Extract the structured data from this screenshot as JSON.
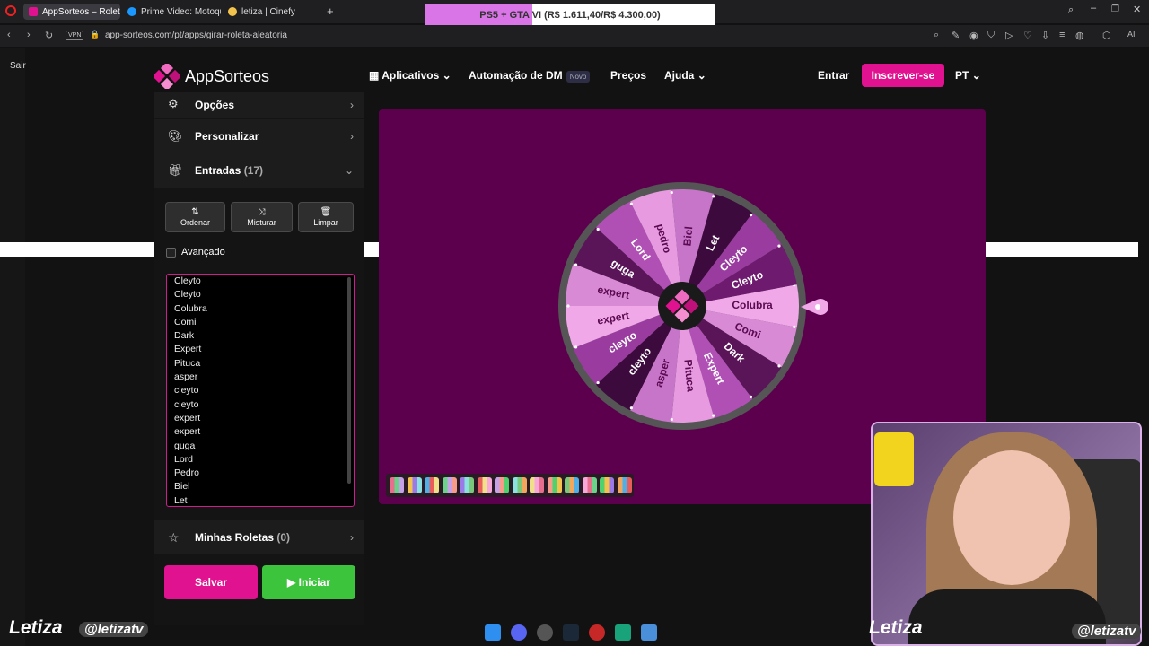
{
  "browser": {
    "tabs": [
      {
        "label": "AppSorteos – Roleta Alea",
        "active": true
      },
      {
        "label": "Prime Video: Motoqueiro"
      },
      {
        "label": "letiza | Cinefy"
      }
    ],
    "new_tab": "+",
    "promo": "PS5 + GTA VI (R$ 1.611,40/R$ 4.300,00)",
    "promo_progress": 0.37,
    "url": "app-sorteos.com/pt/apps/girar-roleta-aleatoria",
    "vpn": "VPN"
  },
  "sidebar": {
    "sair": "Sair"
  },
  "header": {
    "logo": "AppSorteos",
    "nav": {
      "apps": "Aplicativos",
      "dm": "Automação de DM",
      "dm_badge": "Novo",
      "prices": "Preços",
      "help": "Ajuda"
    },
    "login": "Entrar",
    "signup": "Inscrever-se",
    "lang": "PT"
  },
  "panel": {
    "options": "Opções",
    "customize": "Personalizar",
    "entries": "Entradas",
    "entries_count": "(17)",
    "tools": {
      "sort": "Ordenar",
      "shuffle": "Misturar",
      "clear": "Limpar"
    },
    "advanced": "Avançado",
    "entries_list": [
      "Cleyto",
      "Cleyto",
      "Colubra",
      "Comi",
      "Dark",
      "Expert",
      "Pituca",
      "asper",
      "cleyto",
      "cleyto",
      "expert",
      "expert",
      "guga",
      "Lord",
      "Pedro",
      "Biel",
      "Let"
    ],
    "my_wheels": "Minhas Roletas",
    "my_wheels_count": "(0)",
    "save": "Salvar",
    "start": "Iniciar"
  },
  "wheel": {
    "segments": [
      "Colubra",
      "Comi",
      "Dark",
      "Expert",
      "Pituca",
      "asper",
      "cleyto",
      "cleyto",
      "expert",
      "expert",
      "guga",
      "Lord",
      "pedro",
      "Biel",
      "Let",
      "Cleyto",
      "Cleyto"
    ],
    "colors": [
      "#f0a8e8",
      "#d98ad5",
      "#5a1458",
      "#b050b5",
      "#e79ae0",
      "#c675c8",
      "#3c0a3c",
      "#9a3c9f",
      "#f0a8e8",
      "#d98ad5",
      "#5a1458",
      "#b050b5",
      "#e79ae0",
      "#c675c8",
      "#3c0a3c",
      "#9a3c9f",
      "#6e1a6e"
    ],
    "text_dark": [
      true,
      true,
      false,
      false,
      true,
      true,
      false,
      false,
      true,
      true,
      false,
      false,
      true,
      true,
      false,
      false,
      false
    ]
  },
  "palette_colors": [
    "#e86e8d",
    "#f3c34e",
    "#4fb0e8",
    "#6ad38a",
    "#9b7ae8",
    "#e85c5c",
    "#c7a1e8",
    "#8be0e0",
    "#f0e08a",
    "#f79c8a",
    "#7ac97a",
    "#f7a8d8",
    "#4fd26e",
    "#f2a85c"
  ],
  "streamer": {
    "name": "Letiza",
    "handle": "@letizatv"
  },
  "colors": {
    "accent": "#e0128f",
    "start": "#3dc43d",
    "wheel_bg": "#5c004e"
  }
}
